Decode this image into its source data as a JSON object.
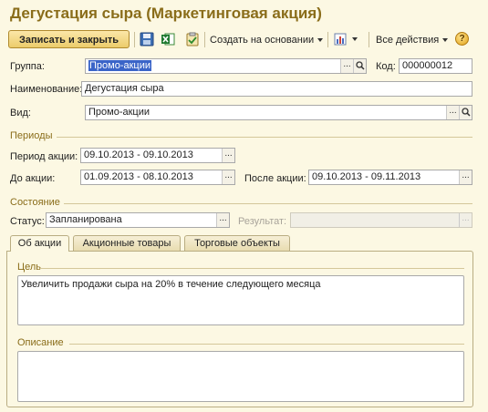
{
  "window": {
    "title": "Дегустация сыра (Маркетинговая акция)"
  },
  "toolbar": {
    "save_close_label": "Записать и закрыть",
    "create_based_label": "Создать на основании",
    "all_actions_label": "Все действия",
    "help_label": "?"
  },
  "form": {
    "group_label": "Группа:",
    "group_value": "Промо-акции",
    "code_label": "Код:",
    "code_value": "000000012",
    "name_label": "Наименование:",
    "name_value": "Дегустация сыра",
    "kind_label": "Вид:",
    "kind_value": "Промо-акции"
  },
  "periods": {
    "section_label": "Периоды",
    "action_period_label": "Период акции:",
    "action_period_value": "09.10.2013 - 09.10.2013",
    "before_label": "До акции:",
    "before_value": "01.09.2013 - 08.10.2013",
    "after_label": "После акции:",
    "after_value": "09.10.2013 - 09.11.2013"
  },
  "state": {
    "section_label": "Состояние",
    "status_label": "Статус:",
    "status_value": "Запланирована",
    "result_label": "Результат:",
    "result_value": ""
  },
  "tabs": [
    {
      "label": "Об акции"
    },
    {
      "label": "Акционные товары"
    },
    {
      "label": "Торговые объекты"
    }
  ],
  "about": {
    "goal_label": "Цель",
    "goal_text": "Увеличить продажи сыра на 20% в течение следующего месяца",
    "description_label": "Описание",
    "description_text": ""
  },
  "colors": {
    "background": "#fcf8e3",
    "title": "#8a6d1a",
    "accent_button": "#eccc6b",
    "selection": "#3a64c8"
  }
}
